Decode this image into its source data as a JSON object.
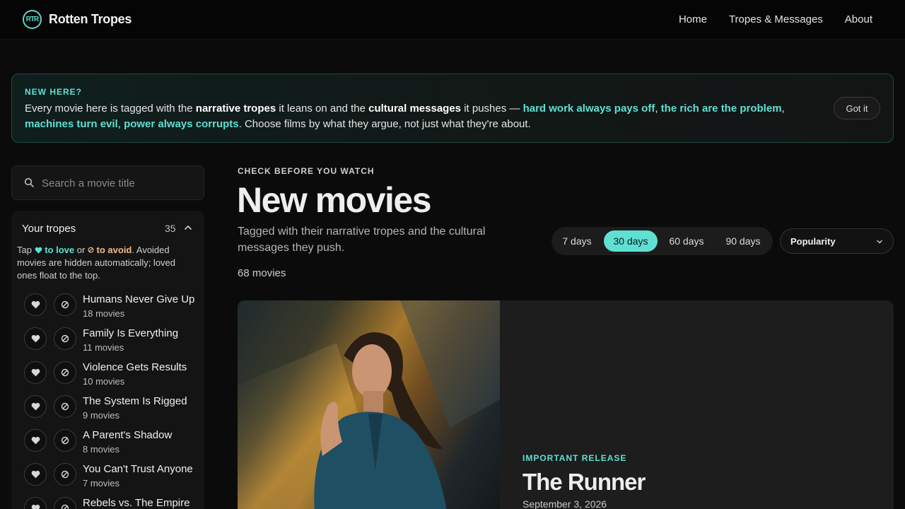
{
  "header": {
    "logo_text": "RTR",
    "brand": "Rotten Tropes",
    "nav": [
      {
        "label": "Home"
      },
      {
        "label": "Tropes & Messages"
      },
      {
        "label": "About"
      }
    ]
  },
  "banner": {
    "kicker": "NEW HERE?",
    "text_1": "Every movie here is tagged with the ",
    "bold_1": "narrative tropes",
    "text_2": " it leans on and the ",
    "bold_2": "cultural messages",
    "text_3": " it pushes — ",
    "hl_1": "hard work always pays off",
    "sep_1": ", ",
    "hl_2": "the rich are the problem",
    "sep_2": ", ",
    "hl_3": "machines turn evil",
    "sep_3": ", ",
    "hl_4": "power always corrupts",
    "text_4": ". Choose films by what they argue, not just what they're about.",
    "button": "Got it"
  },
  "search": {
    "placeholder": "Search a movie title"
  },
  "tropes_panel": {
    "title": "Your tropes",
    "count": "35",
    "help_1": "Tap ",
    "help_love": "to love",
    "help_2": " or ",
    "help_avoid": "to avoid",
    "help_3": ". Avoided movies are hidden automatically; loved ones float to the top.",
    "items": [
      {
        "name": "Humans Never Give Up",
        "count": "18 movies"
      },
      {
        "name": "Family Is Everything",
        "count": "11 movies"
      },
      {
        "name": "Violence Gets Results",
        "count": "10 movies"
      },
      {
        "name": "The System Is Rigged",
        "count": "9 movies"
      },
      {
        "name": "A Parent's Shadow",
        "count": "8 movies"
      },
      {
        "name": "You Can't Trust Anyone",
        "count": "7 movies"
      },
      {
        "name": "Rebels vs. The Empire",
        "count": ""
      }
    ]
  },
  "main": {
    "kicker": "CHECK BEFORE YOU WATCH",
    "title": "New movies",
    "subtitle": "Tagged with their narrative tropes and the cultural messages they push.",
    "count": "68 movies",
    "ranges": [
      {
        "label": "7 days",
        "active": false
      },
      {
        "label": "30 days",
        "active": true
      },
      {
        "label": "60 days",
        "active": false
      },
      {
        "label": "90 days",
        "active": false
      }
    ],
    "sort": "Popularity"
  },
  "feature": {
    "kicker": "IMPORTANT RELEASE",
    "title": "The Runner",
    "date": "September 3, 2026"
  },
  "colors": {
    "accent": "#5fe0d3",
    "avoid": "#f2b98a",
    "background": "#0b0b0b",
    "card": "#1d1d1d"
  }
}
